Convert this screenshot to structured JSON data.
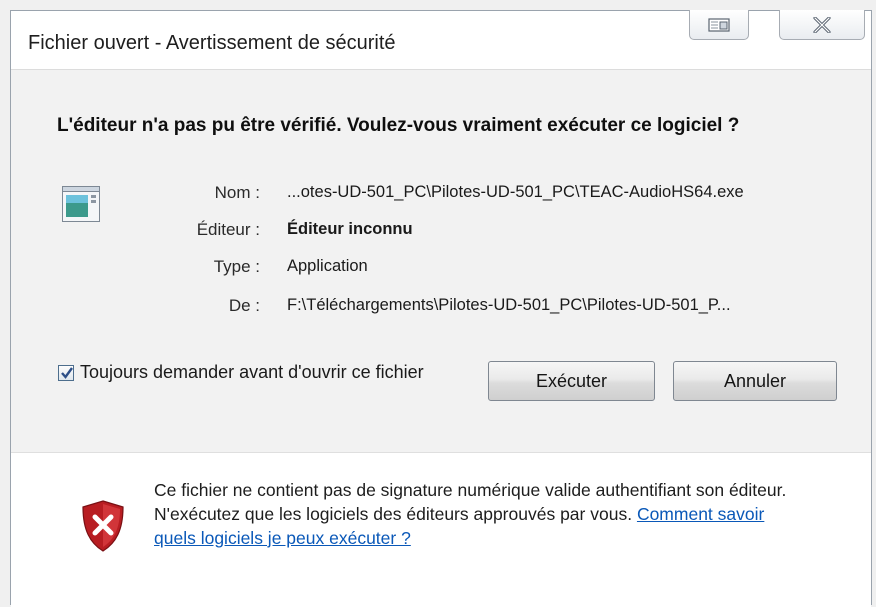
{
  "window": {
    "title": "Fichier ouvert - Avertissement de sécurité"
  },
  "titlebar_buttons": {
    "restore_icon": "restore-icon",
    "close_icon": "close-icon"
  },
  "main": {
    "headline": "L'éditeur n'a pas pu être vérifié. Voulez-vous vraiment exécuter ce logiciel ?",
    "details": {
      "name_label": "Nom :",
      "name_value": "...otes-UD-501_PC\\Pilotes-UD-501_PC\\TEAC-AudioHS64.exe",
      "publisher_label": "Éditeur :",
      "publisher_value": "Éditeur inconnu",
      "type_label": "Type :",
      "type_value": "Application",
      "from_label": "De :",
      "from_value": "F:\\Téléchargements\\Pilotes-UD-501_PC\\Pilotes-UD-501_P..."
    },
    "buttons": {
      "run": "Exécuter",
      "cancel": "Annuler"
    },
    "checkbox": {
      "label": "Toujours demander avant d'ouvrir ce fichier",
      "checked": true
    }
  },
  "footer": {
    "warning_text": "Ce fichier ne contient pas de signature numérique valide authentifiant son éditeur. N'exécutez que les logiciels des éditeurs approuvés par vous.",
    "link_text": "Comment savoir quels logiciels je peux exécuter ?"
  },
  "colors": {
    "link": "#0a58b8",
    "shield": "#c8252b"
  }
}
